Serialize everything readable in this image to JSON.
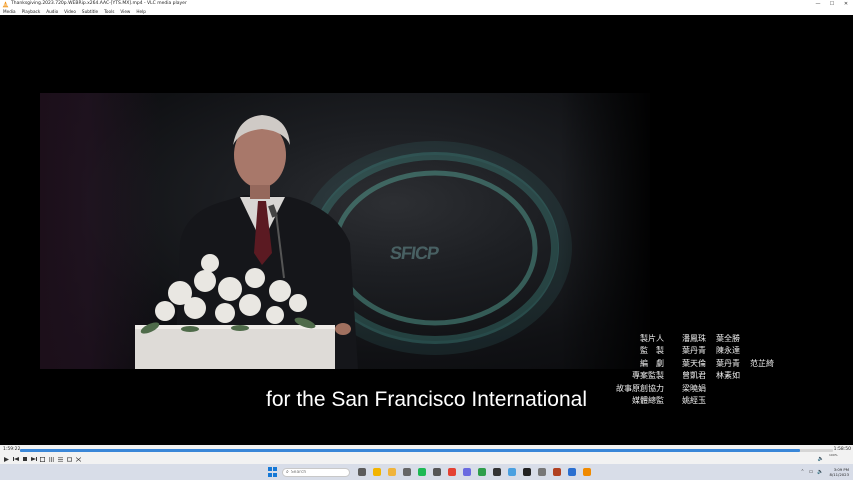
{
  "window": {
    "title": "Thanksgiving.2023.720p.WEBRip.x264.AAC-[YTS.MX].mp4 - VLC media player",
    "controls": {
      "minimize": "—",
      "maximize": "☐",
      "close": "✕"
    }
  },
  "menu": [
    "Media",
    "Playback",
    "Audio",
    "Video",
    "Subtitle",
    "Tools",
    "View",
    "Help"
  ],
  "video": {
    "subtitle": "for the San Francisco International",
    "logo_text": "SFICP",
    "credits": [
      {
        "role": "製片人",
        "names": [
          "潘鳳珠",
          "葉全勝"
        ]
      },
      {
        "role": "監　製",
        "names": [
          "葉丹青",
          "陳永達"
        ]
      },
      {
        "role": "編　劇",
        "names": [
          "葉天倫",
          "葉丹青",
          "范芷綺"
        ]
      },
      {
        "role": "專案監製",
        "names": [
          "曾凱君",
          "林素如"
        ]
      },
      {
        "role": "故事原創協力",
        "names": [
          "梁曉娟"
        ]
      },
      {
        "role": "媒體總監",
        "names": [
          "姚經玉"
        ]
      }
    ]
  },
  "player": {
    "time_current": "1:59:22",
    "time_total": "1:58:50",
    "progress": 0.96,
    "volume_label": "100%",
    "volume": 1.0
  },
  "taskbar": {
    "search_placeholder": "Search",
    "clock_time": "3:09 PM",
    "clock_date": "8/11/2023",
    "app_colors": [
      "#5b5b5b",
      "#f2b400",
      "#f0b43c",
      "#666",
      "#1db954",
      "#555",
      "#e44133",
      "#6a6ae0",
      "#2e9e4a",
      "#333",
      "#4aa0e0",
      "#222",
      "#777",
      "#b04020",
      "#2a6fd0",
      "#f08a00"
    ]
  }
}
